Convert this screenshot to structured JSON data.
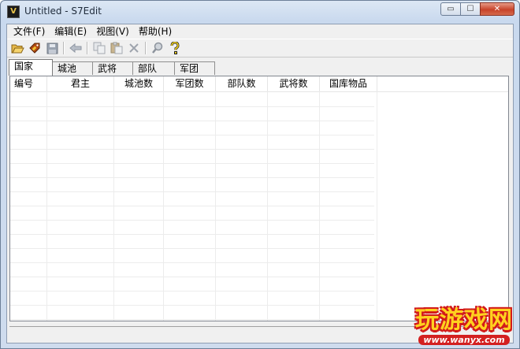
{
  "window": {
    "title": "Untitled - S7Edit",
    "icon_label": "V",
    "minimize_symbol": "▭",
    "maximize_symbol": "☐",
    "close_symbol": "✕"
  },
  "menu": [
    {
      "label": "文件(F)"
    },
    {
      "label": "编辑(E)"
    },
    {
      "label": "视图(V)"
    },
    {
      "label": "帮助(H)"
    }
  ],
  "toolbar": {
    "icons": [
      "open-folder-icon",
      "tag-icon",
      "save-icon",
      "back-arrow-icon",
      "copy-icon",
      "paste-icon",
      "delete-icon",
      "search-icon",
      "help-icon"
    ]
  },
  "tabs": [
    {
      "label": "国家",
      "active": true
    },
    {
      "label": "城池"
    },
    {
      "label": "武将"
    },
    {
      "label": "部队"
    },
    {
      "label": "军团"
    }
  ],
  "list": {
    "columns": [
      "编号",
      "君主",
      "城池数",
      "军团数",
      "部队数",
      "武将数",
      "国库物品"
    ]
  },
  "watermark": {
    "logo_text": "玩游戏网",
    "url": "www.wanyx.com"
  },
  "colors": {
    "title_bg": "#cfdcee",
    "close_button": "#c8432a",
    "watermark_yellow": "#ffd21f",
    "watermark_red": "#d21a1a"
  }
}
